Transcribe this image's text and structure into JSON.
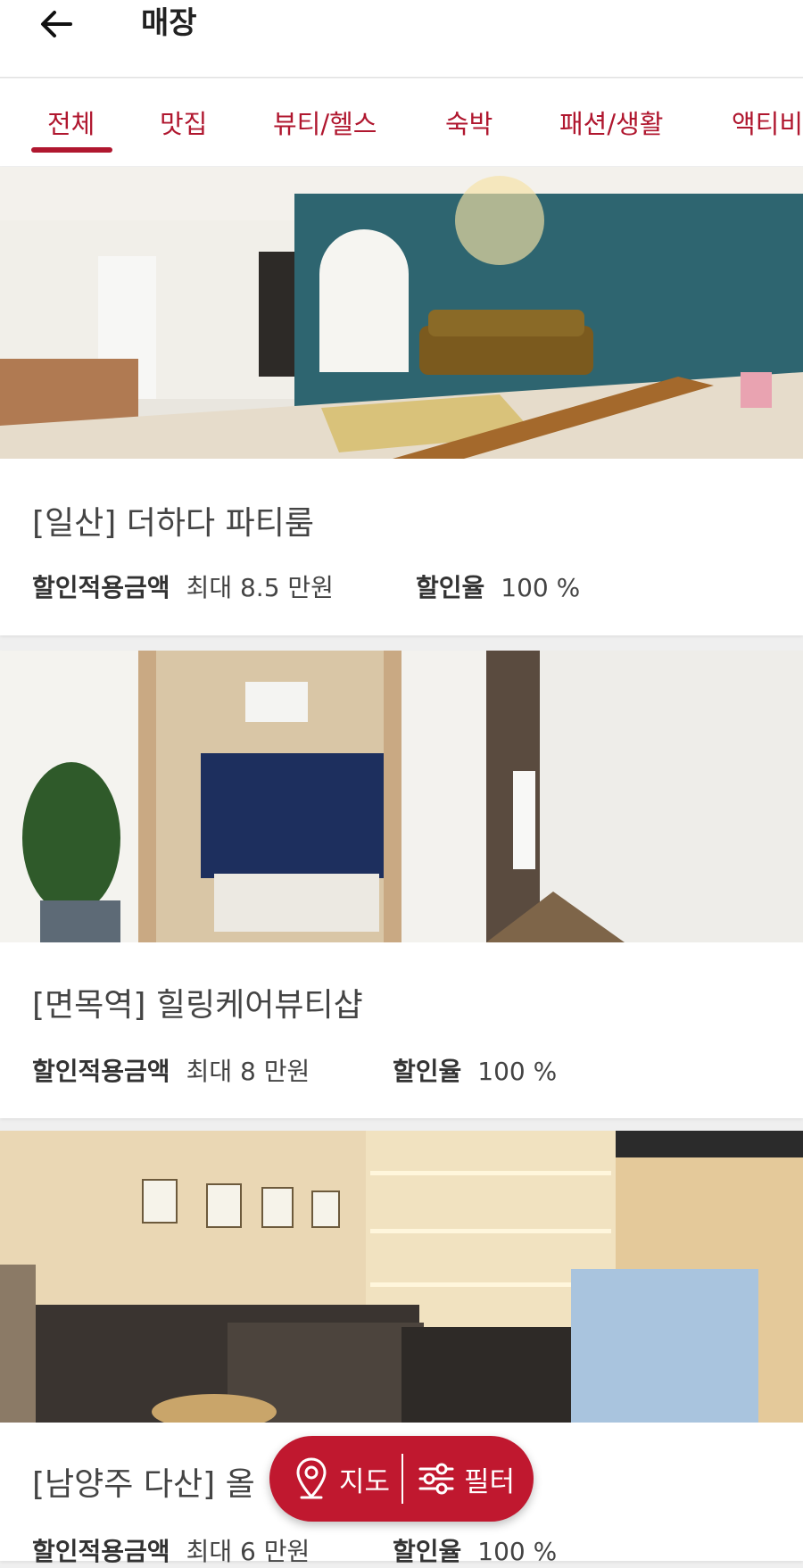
{
  "header": {
    "title": "매장"
  },
  "tabs": [
    {
      "label": "전체"
    },
    {
      "label": "맛집"
    },
    {
      "label": "뷰티/헬스"
    },
    {
      "label": "숙박"
    },
    {
      "label": "패션/생활"
    },
    {
      "label": "액티비"
    }
  ],
  "stores": [
    {
      "name": "[일산] 더하다 파티룸",
      "discount_label": "할인적용금액",
      "discount_value": "최대 8.5 만원",
      "rate_label": "할인율",
      "rate_value": "100 %"
    },
    {
      "name": "[면목역] 힐링케어뷰티샵",
      "discount_label": "할인적용금액",
      "discount_value": "최대 8 만원",
      "rate_label": "할인율",
      "rate_value": "100 %"
    },
    {
      "name": "[남양주 다산] 올",
      "discount_label": "할인적용금액",
      "discount_value": "최대 6 만원",
      "rate_label": "할인율",
      "rate_value": "100 %"
    }
  ],
  "fab": {
    "map_label": "지도",
    "filter_label": "필터"
  },
  "colors": {
    "accent": "#c0182f",
    "tab_text": "#b0172f"
  }
}
